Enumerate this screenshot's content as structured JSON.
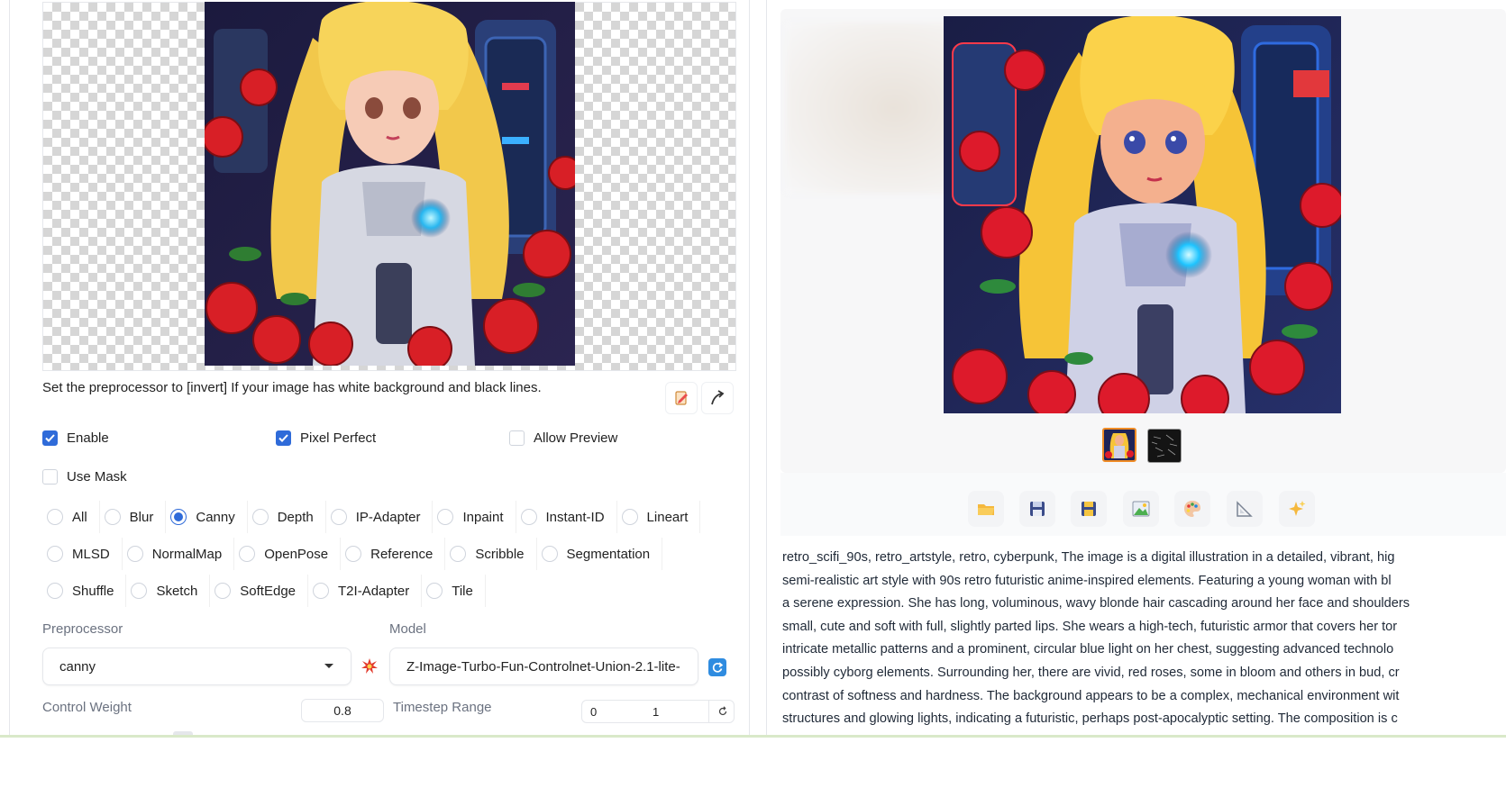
{
  "controlnet": {
    "hint_text": "Set the preprocessor to [invert] If your image has white background and black lines.",
    "enable": {
      "label": "Enable",
      "checked": true
    },
    "pixel_perfect": {
      "label": "Pixel Perfect",
      "checked": true
    },
    "allow_preview": {
      "label": "Allow Preview",
      "checked": false
    },
    "use_mask": {
      "label": "Use Mask",
      "checked": false
    },
    "control_types": [
      "All",
      "Blur",
      "Canny",
      "Depth",
      "IP-Adapter",
      "Inpaint",
      "Instant-ID",
      "Lineart",
      "MLSD",
      "NormalMap",
      "OpenPose",
      "Reference",
      "Scribble",
      "Segmentation",
      "Shuffle",
      "Sketch",
      "SoftEdge",
      "T2I-Adapter",
      "Tile"
    ],
    "selected_control_type": "Canny",
    "preprocessor_label": "Preprocessor",
    "preprocessor_value": "canny",
    "model_label": "Model",
    "model_value": "Z-Image-Turbo-Fun-Controlnet-Union-2.1-lite-",
    "control_weight_label": "Control Weight",
    "control_weight_value": "0.8",
    "timestep_label": "Timestep Range",
    "timestep_start": "0",
    "timestep_end": "1"
  },
  "output": {
    "toolbar_icons": [
      "folder-icon",
      "save-icon",
      "zip-save-icon",
      "image-icon",
      "palette-icon",
      "ruler-icon",
      "sparkle-icon"
    ],
    "caption_lines": [
      "retro_scifi_90s, retro_artstyle, retro, cyberpunk, The image is a digital illustration in a detailed, vibrant, hig",
      "semi-realistic art style with 90s retro futuristic anime-inspired elements. Featuring a young woman with bl",
      "a serene expression. She has long, voluminous, wavy blonde hair cascading around her face and shoulders",
      "small, cute and soft with full, slightly parted lips. She wears a high-tech, futuristic armor that covers her tor",
      "intricate metallic patterns and a prominent, circular blue light on her chest, suggesting advanced technolo",
      "possibly cyborg elements. Surrounding her, there are vivid, red roses, some in bloom and others in bud, cr",
      "contrast of softness and hardness. The background appears to be a complex, mechanical environment wit",
      "structures and glowing lights, indicating a futuristic, perhaps post-apocalyptic setting. The composition is c"
    ]
  },
  "colors": {
    "accent": "#2f6bd9",
    "border": "#e5e7eb",
    "muted_text": "#6b7280"
  }
}
